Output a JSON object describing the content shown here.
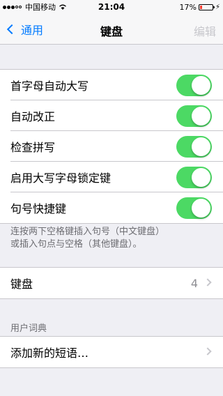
{
  "status_bar": {
    "carrier": "中国移动",
    "time": "21:04",
    "battery_percent": "17%",
    "battery_level": 0.17,
    "signal_dots_filled": 3,
    "signal_dots_total": 5
  },
  "nav": {
    "back_label": "通用",
    "title": "键盘",
    "edit_label": "编辑"
  },
  "toggles": [
    {
      "label": "首字母自动大写",
      "on": true
    },
    {
      "label": "自动改正",
      "on": true
    },
    {
      "label": "检查拼写",
      "on": true
    },
    {
      "label": "启用大写字母锁定键",
      "on": true
    },
    {
      "label": "句号快捷键",
      "on": true
    }
  ],
  "footer_note": {
    "line1": "连按两下空格键插入句号（中文键盘）",
    "line2": "或插入句点与空格（其他键盘）。"
  },
  "keyboards_row": {
    "label": "键盘",
    "value": "4"
  },
  "user_dictionary": {
    "header": "用户词典",
    "add_phrase_label": "添加新的短语…"
  },
  "colors": {
    "accent": "#007aff",
    "toggle_on": "#4cd964",
    "background": "#efeff4"
  }
}
